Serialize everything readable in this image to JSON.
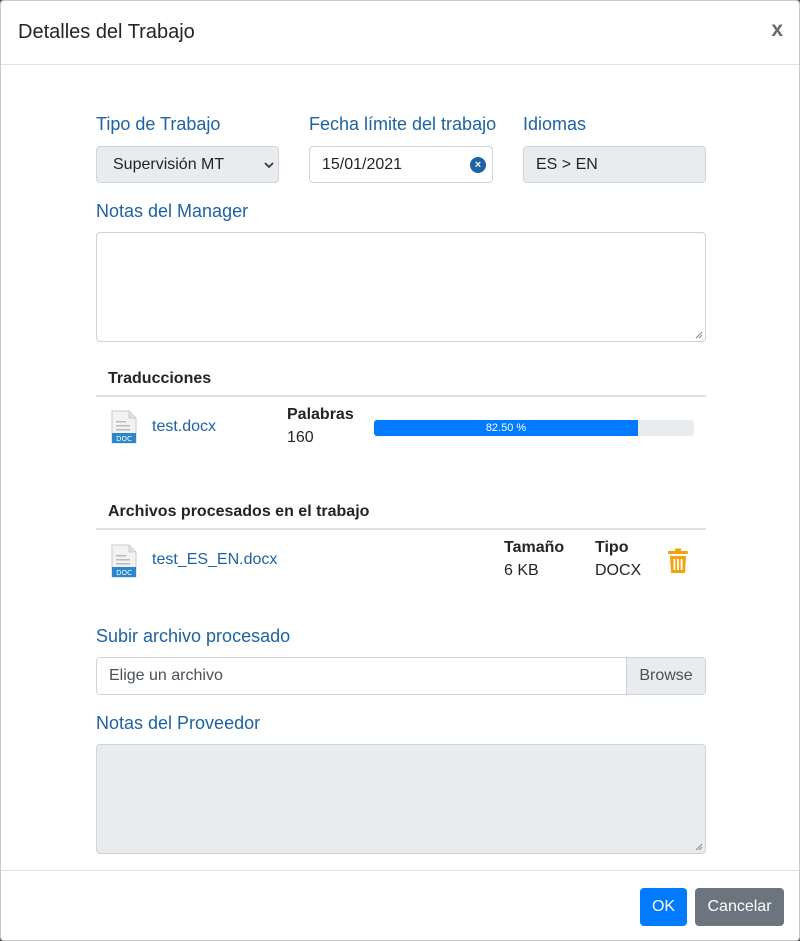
{
  "dialog": {
    "title": "Detalles del Trabajo",
    "close_label": "x"
  },
  "form": {
    "job_type": {
      "label": "Tipo de Trabajo",
      "value": "Supervisión MT"
    },
    "deadline": {
      "label": "Fecha límite del trabajo",
      "value": "15/01/2021",
      "clear_icon": "clear-icon"
    },
    "languages": {
      "label": "Idiomas",
      "value": "ES > EN"
    },
    "manager_notes": {
      "label": "Notas del Manager",
      "value": ""
    },
    "upload": {
      "label": "Subir archivo procesado",
      "placeholder": "Elige un archivo",
      "browse_label": "Browse"
    },
    "provider_notes": {
      "label": "Notas del Proveedor",
      "value": ""
    }
  },
  "translations": {
    "title": "Traducciones",
    "items": [
      {
        "file": "test.docx",
        "icon": "doc-file-icon",
        "words_label": "Palabras",
        "words": "160",
        "progress_text": "82.50 %",
        "progress": 0.825
      }
    ]
  },
  "processed": {
    "title": "Archivos procesados en el trabajo",
    "items": [
      {
        "file": "test_ES_EN.docx",
        "icon": "doc-file-icon",
        "size_label": "Tamaño",
        "size": "6 KB",
        "type_label": "Tipo",
        "type": "DOCX",
        "delete_icon": "trash-icon"
      }
    ]
  },
  "footer": {
    "ok_label": "OK",
    "cancel_label": "Cancelar"
  },
  "colors": {
    "accent": "#1d62a3",
    "primary": "#007bff",
    "secondary": "#6c757d",
    "warning": "#f0a30a"
  }
}
